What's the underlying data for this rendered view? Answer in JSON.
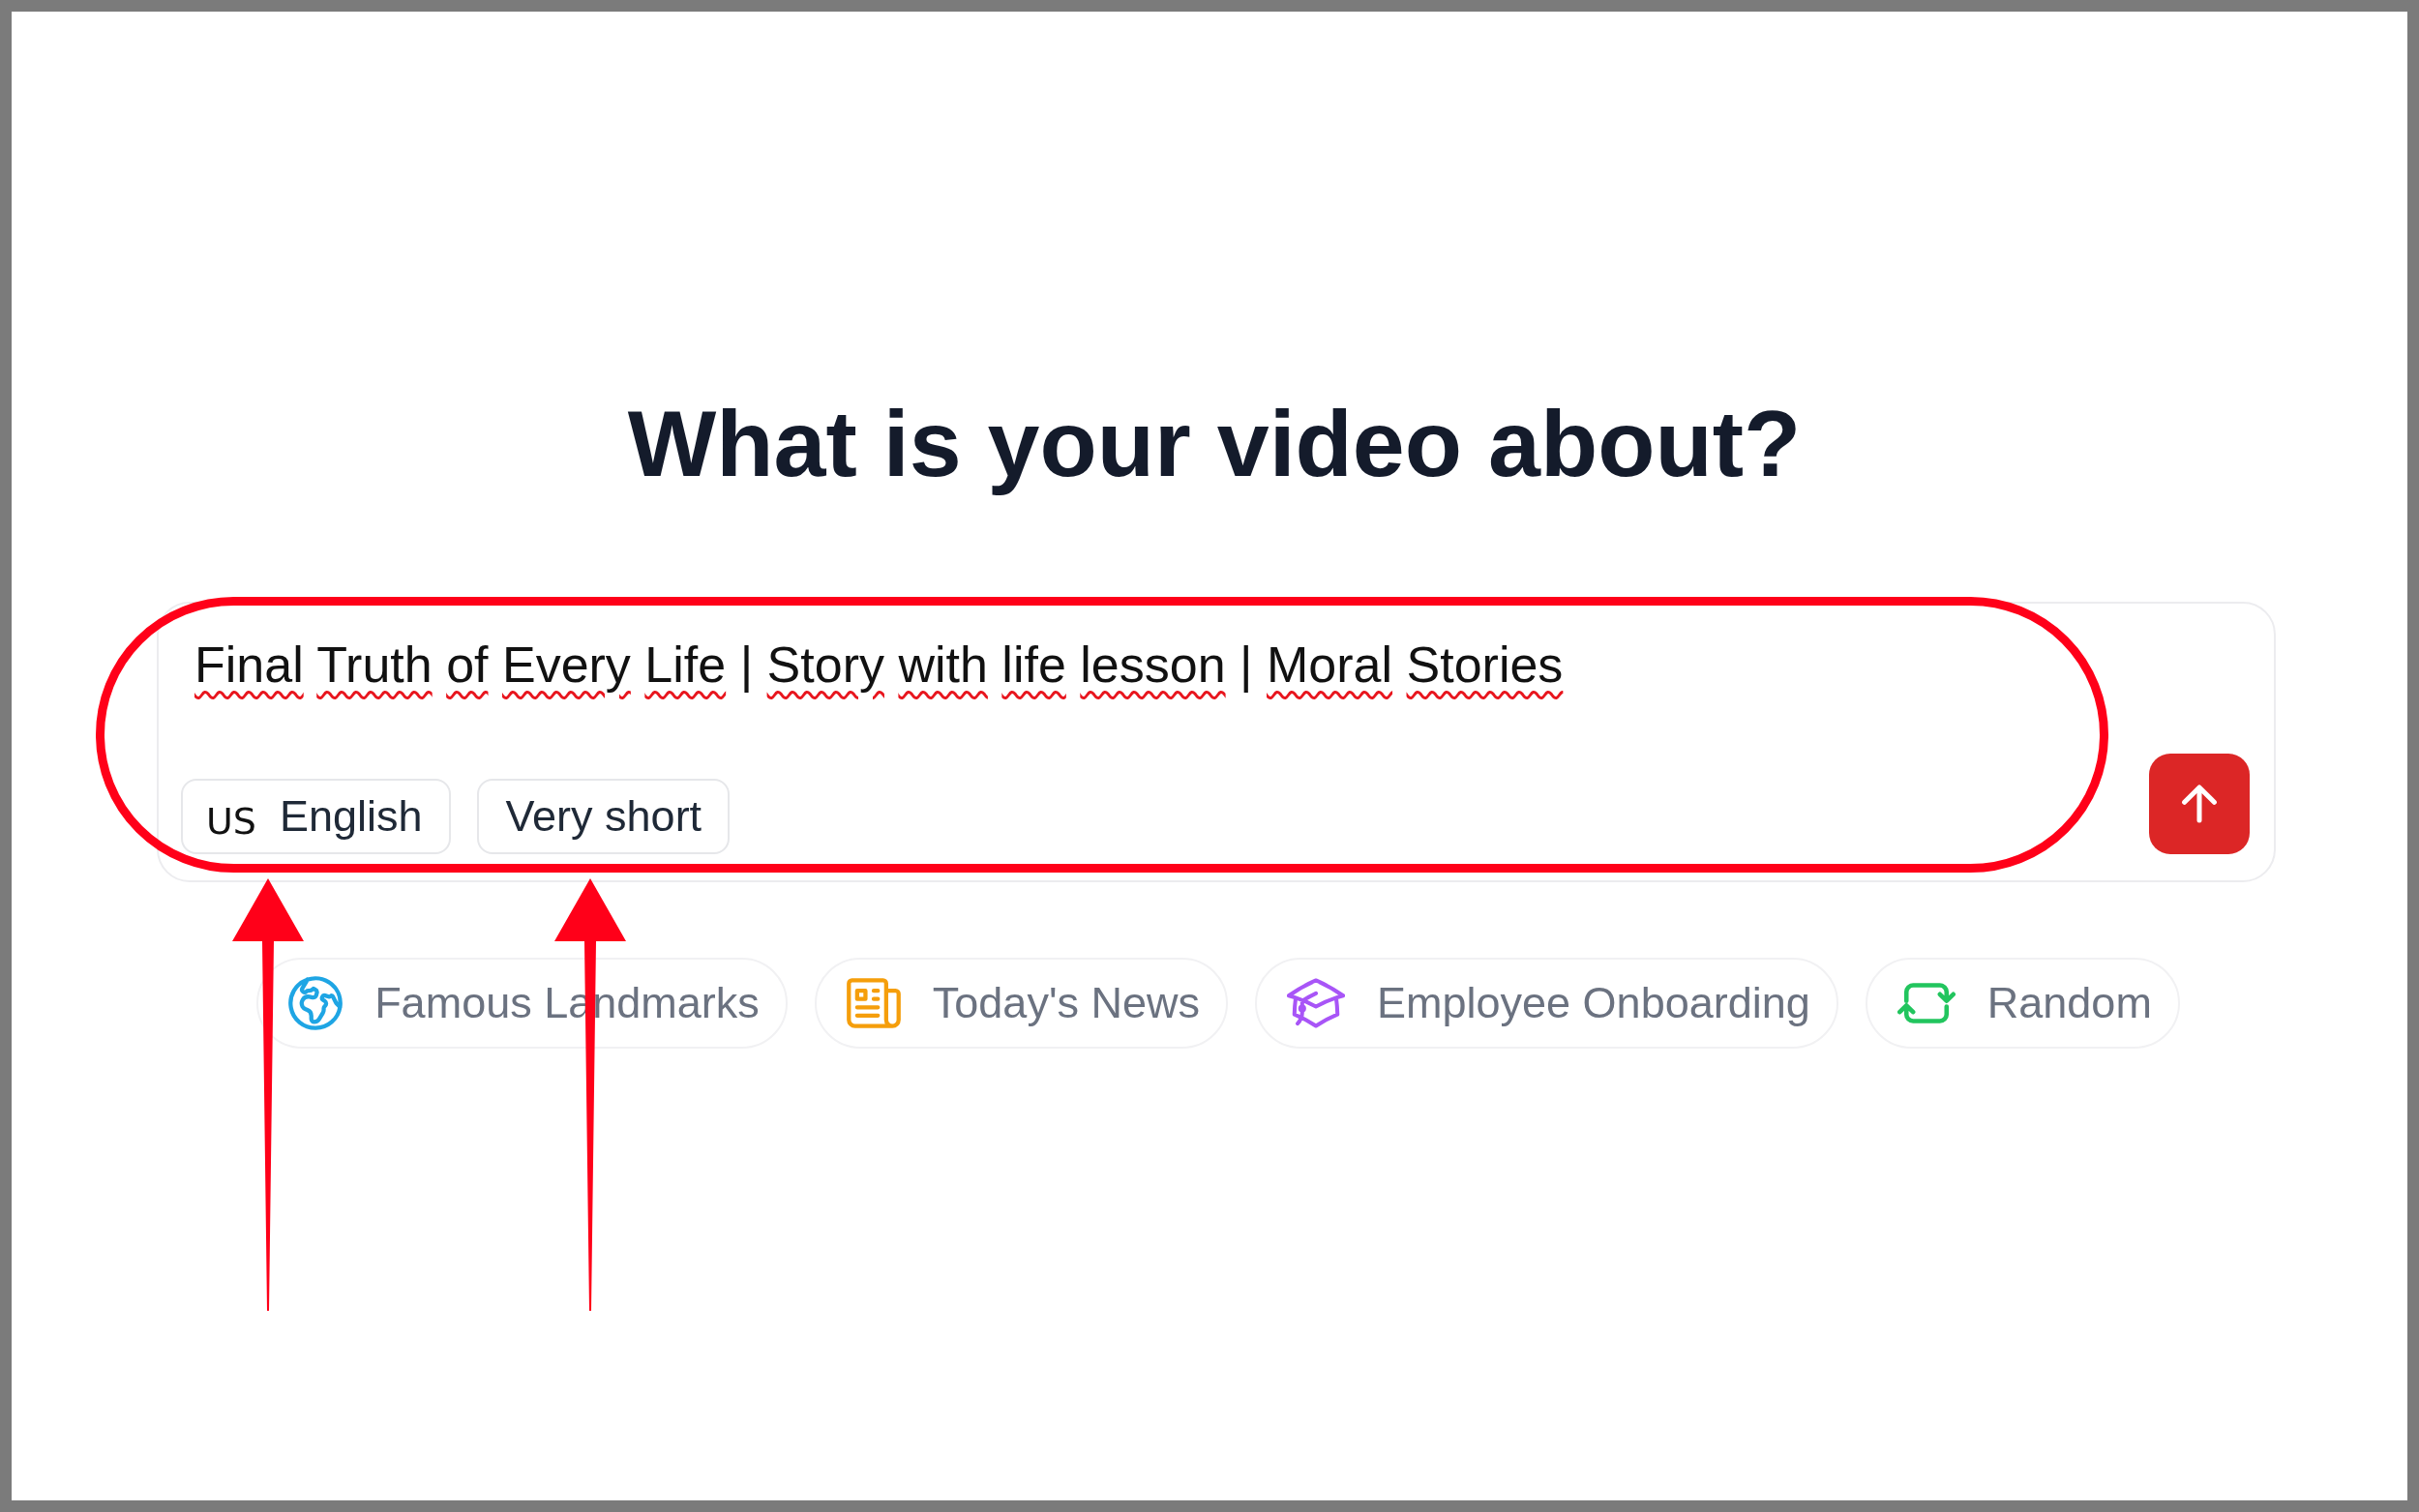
{
  "title": "What is your video about?",
  "prompt": {
    "value": "Final Truth of Every Life | Story with life lesson | Moral Stories",
    "spellcheck_underlines": true,
    "options": [
      {
        "kind": "language",
        "flag": "US",
        "label": "English"
      },
      {
        "kind": "length",
        "label": "Very short"
      }
    ]
  },
  "suggestions": [
    {
      "kind": "landmarks",
      "label": "Famous Landmarks"
    },
    {
      "kind": "news",
      "label": "Today's News"
    },
    {
      "kind": "onboarding",
      "label": "Employee Onboarding"
    },
    {
      "kind": "random",
      "label": "Random"
    }
  ],
  "annotations": [
    {
      "kind": "outline"
    },
    {
      "kind": "arrow"
    },
    {
      "kind": "arrow"
    }
  ]
}
